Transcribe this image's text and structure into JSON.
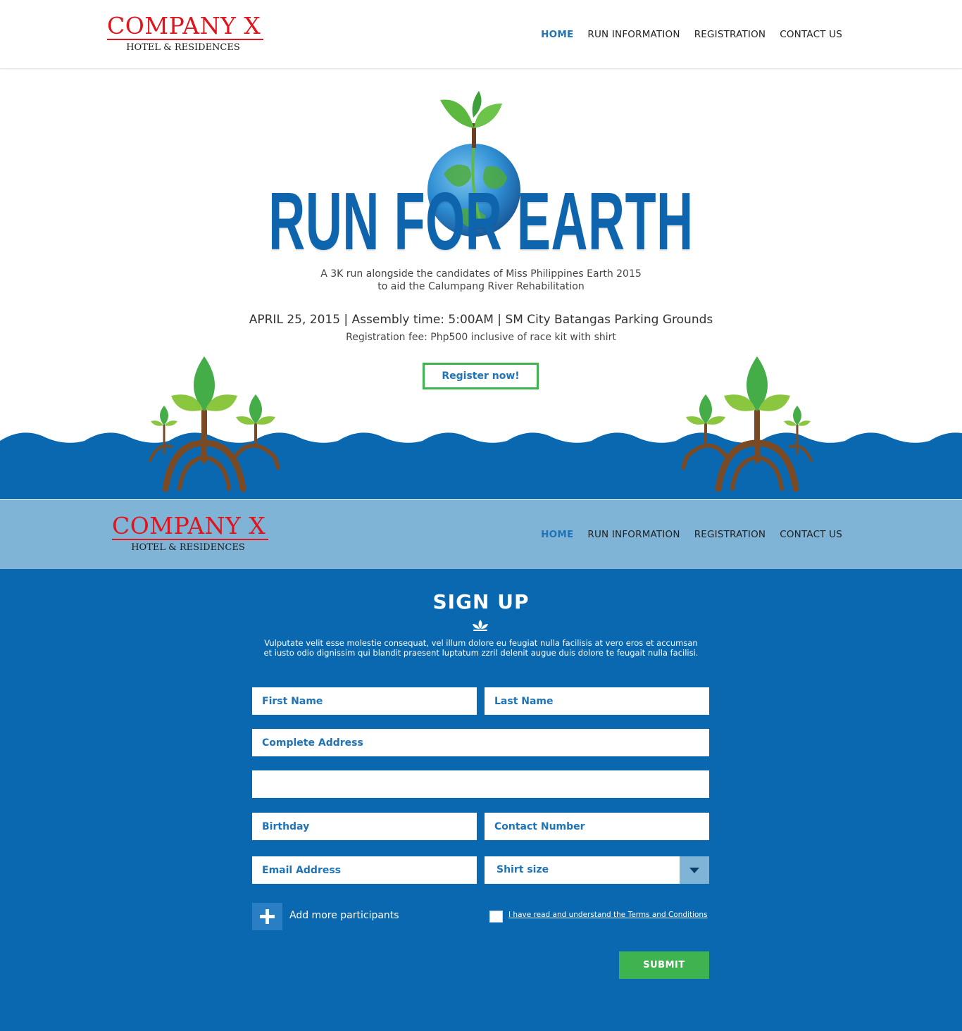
{
  "brand": {
    "name": "COMPANY X",
    "tagline": "HOTEL & RESIDENCES",
    "red": "#e0141c",
    "blue": "#0968b0",
    "light_blue": "#80b4d7",
    "green": "#3fb34f"
  },
  "nav": {
    "items": [
      {
        "label": "HOME",
        "active": true
      },
      {
        "label": "RUN INFORMATION",
        "active": false
      },
      {
        "label": "REGISTRATION",
        "active": false
      },
      {
        "label": "CONTACT US",
        "active": false
      }
    ]
  },
  "hero": {
    "title": "RUN FOR EARTH",
    "subtitle_line1": "A 3K run alongside the candidates of Miss Philippines Earth 2015",
    "subtitle_line2": "to aid the Calumpang River Rehabilitation",
    "details": "APRIL 25, 2015 | Assembly time: 5:00AM | SM City Batangas Parking Grounds",
    "fee": "Registration fee: Php500 inclusive of race kit with shirt",
    "register_label": "Register now!",
    "icons": [
      "globe-sprout-icon",
      "mangrove-tree-icon",
      "wave-icon"
    ]
  },
  "signup": {
    "title": "SIGN UP",
    "desc_line1": "Vulputate velit esse molestie consequat, vel illum dolore eu feugiat nulla facilisis at vero eros et accumsan",
    "desc_line2": "et iusto odio dignissim qui blandit praesent luptatum zzril delenit augue duis dolore te feugait nulla facilisi.",
    "fields": {
      "first_name": {
        "placeholder": "First Name",
        "value": ""
      },
      "last_name": {
        "placeholder": "Last Name",
        "value": ""
      },
      "address": {
        "placeholder": "Complete Address",
        "value": ""
      },
      "address2": {
        "placeholder": "",
        "value": ""
      },
      "birthday": {
        "placeholder": "Birthday",
        "value": ""
      },
      "contact": {
        "placeholder": "Contact Number",
        "value": ""
      },
      "email": {
        "placeholder": "Email Address",
        "value": ""
      }
    },
    "shirt_size": {
      "selected": "Shirt size"
    },
    "add_participants": "Add more participants",
    "terms": "I have read and understand the Terms and Conditions",
    "terms_checked": false,
    "submit": "SUBMIT"
  }
}
